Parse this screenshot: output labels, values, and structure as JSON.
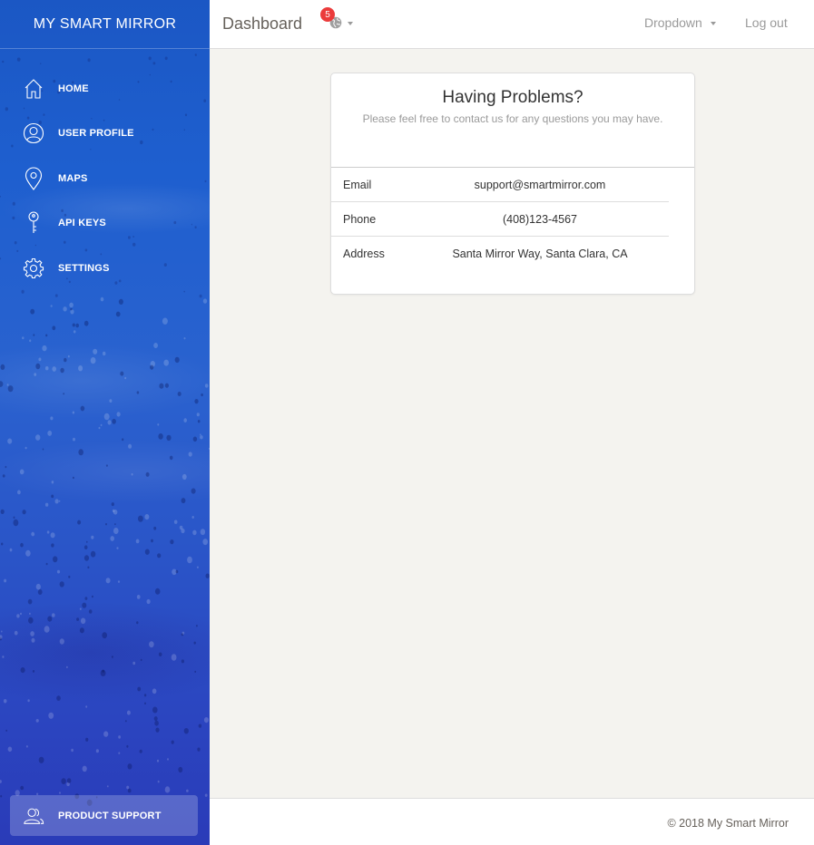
{
  "sidebar": {
    "brand": "MY SMART MIRROR",
    "items": [
      {
        "label": "HOME",
        "icon": "home-icon"
      },
      {
        "label": "USER PROFILE",
        "icon": "user-icon"
      },
      {
        "label": "MAPS",
        "icon": "map-pin-icon"
      },
      {
        "label": "API KEYS",
        "icon": "key-icon"
      },
      {
        "label": "SETTINGS",
        "icon": "gear-icon"
      }
    ],
    "support": {
      "label": "PRODUCT SUPPORT",
      "icon": "users-icon"
    }
  },
  "topbar": {
    "title": "Dashboard",
    "notifications": {
      "count": "5",
      "icon": "globe-icon"
    },
    "dropdown_label": "Dropdown",
    "logout_label": "Log out"
  },
  "card": {
    "title": "Having Problems?",
    "subtitle": "Please feel free to contact us for any questions you may have.",
    "rows": [
      {
        "key": "Email",
        "value": "support@smartmirror.com"
      },
      {
        "key": "Phone",
        "value": "(408)123-4567"
      },
      {
        "key": "Address",
        "value": "Santa Mirror Way, Santa Clara, CA"
      }
    ]
  },
  "footer": {
    "copyright": "© 2018 My Smart Mirror"
  },
  "colors": {
    "sidebar_top": "#1b57c4",
    "sidebar_bottom": "#2a3bb8",
    "badge": "#eb3b3b",
    "content_bg": "#f4f3ef"
  }
}
